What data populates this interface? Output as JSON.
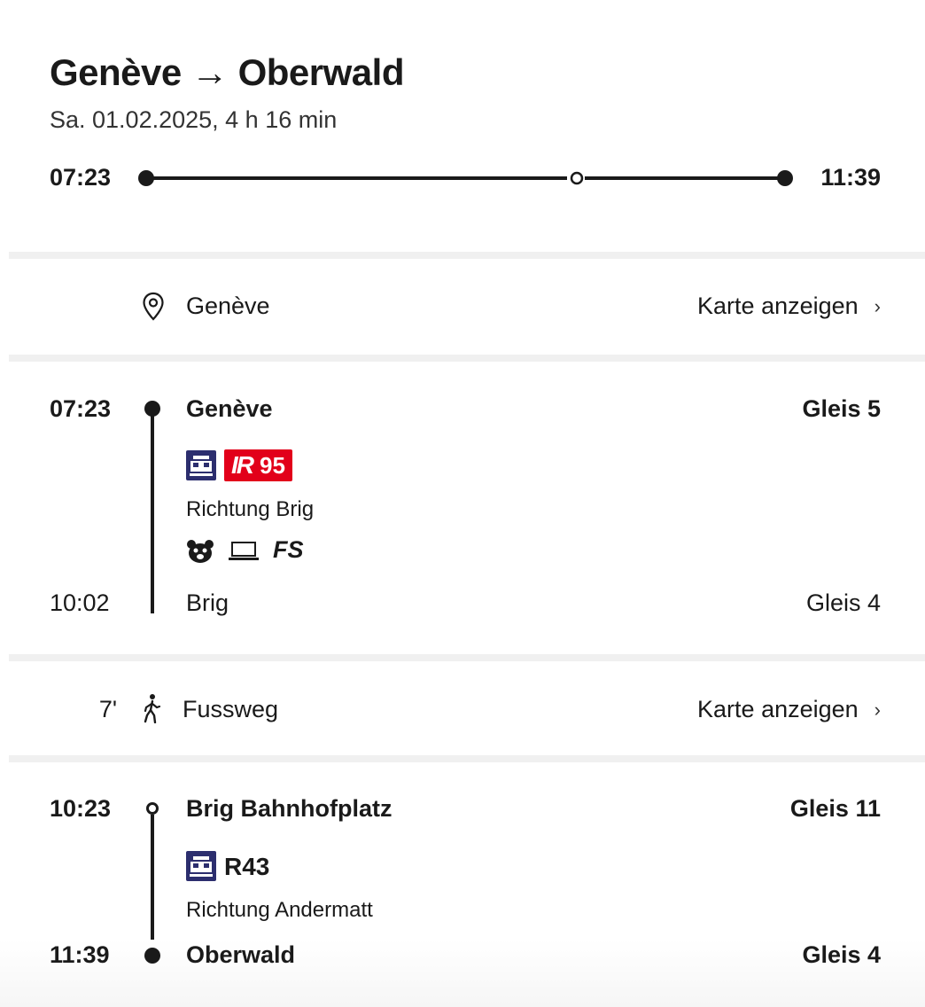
{
  "header": {
    "title": "Genève → Oberwald",
    "subtitle": "Sa. 01.02.2025, 4 h 16 min",
    "departure_time": "07:23",
    "arrival_time": "11:39"
  },
  "origin_row": {
    "icon": "location-pin-icon",
    "station": "Genève",
    "map_link": "Karte anzeigen"
  },
  "legs": [
    {
      "dep_time": "07:23",
      "dep_station": "Genève",
      "dep_platform": "Gleis 5",
      "vehicle_icon": "train-icon",
      "line_prefix": "IR",
      "line_number": "95",
      "line_color": "#e2001a",
      "direction": "Richtung Brig",
      "amenities": [
        "family-car-icon",
        "business-zone-laptop-icon",
        "FS"
      ],
      "arr_time": "10:02",
      "arr_station": "Brig",
      "arr_platform": "Gleis 4"
    },
    {
      "dep_time": "10:23",
      "dep_station": "Brig Bahnhofplatz",
      "dep_platform": "Gleis 11",
      "vehicle_icon": "train-icon",
      "line_name": "R43",
      "direction": "Richtung Andermatt",
      "arr_time": "11:39",
      "arr_station": "Oberwald",
      "arr_platform": "Gleis 4"
    }
  ],
  "walk": {
    "duration": "7'",
    "icon": "walking-person-icon",
    "label": "Fussweg",
    "map_link": "Karte anzeigen"
  },
  "colors": {
    "text": "#1a1a1a",
    "divider": "#f0f0f0",
    "train_icon_bg": "#2c2e6e",
    "ir_red": "#e2001a"
  }
}
